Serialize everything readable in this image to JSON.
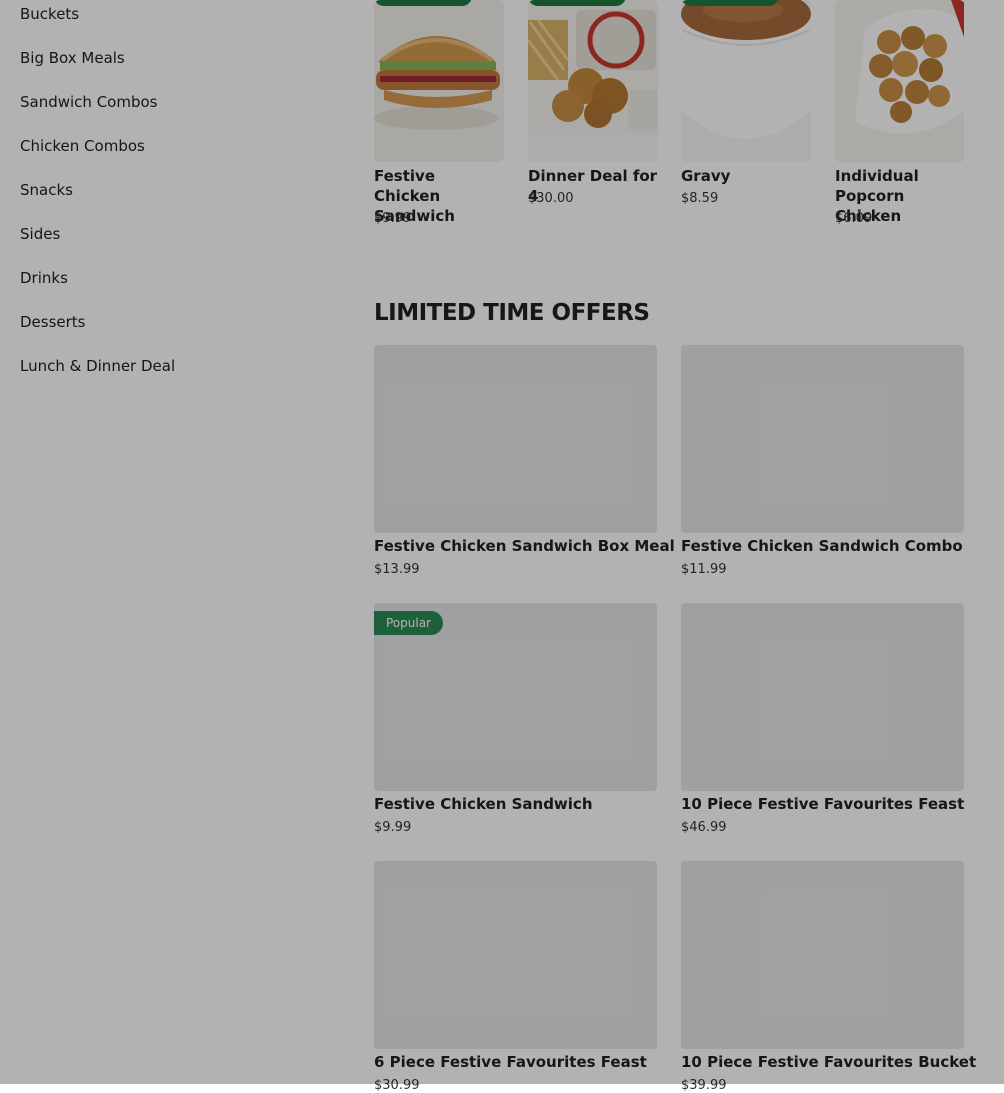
{
  "sidebar": {
    "items": [
      {
        "label": "Buckets"
      },
      {
        "label": "Big Box Meals"
      },
      {
        "label": "Sandwich Combos"
      },
      {
        "label": "Chicken Combos"
      },
      {
        "label": "Snacks"
      },
      {
        "label": "Sides"
      },
      {
        "label": "Drinks"
      },
      {
        "label": "Desserts"
      },
      {
        "label": "Lunch & Dinner Deal"
      }
    ]
  },
  "featured": {
    "items": [
      {
        "title": "Festive Chicken Sandwich",
        "price": "$9.99",
        "icon": "chicken-sandwich-image"
      },
      {
        "title": "Dinner Deal for 4",
        "price": "$30.00",
        "icon": "dinner-deal-image"
      },
      {
        "title": "Gravy",
        "price": "$8.59",
        "icon": "gravy-bowl-image"
      },
      {
        "title": "Individual Popcorn Chicken",
        "price": "$6.09",
        "icon": "popcorn-chicken-image"
      }
    ]
  },
  "limited": {
    "title": "LIMITED TIME OFFERS",
    "items": [
      {
        "title": "Festive Chicken Sandwich Box Meal",
        "price": "$13.99"
      },
      {
        "title": "Festive Chicken Sandwich Combo",
        "price": "$11.99"
      },
      {
        "title": "Festive Chicken Sandwich",
        "price": "$9.99",
        "badge": "Popular"
      },
      {
        "title": "10 Piece Festive Favourites Feast",
        "price": "$46.99"
      },
      {
        "title": "6 Piece Festive Favourites Feast",
        "price": "$30.99"
      },
      {
        "title": "10 Piece Festive Favourites Bucket",
        "price": "$39.99"
      }
    ]
  },
  "colors": {
    "badge_green": "#2b8a55",
    "overlay": "rgba(0,0,0,0.3)"
  }
}
